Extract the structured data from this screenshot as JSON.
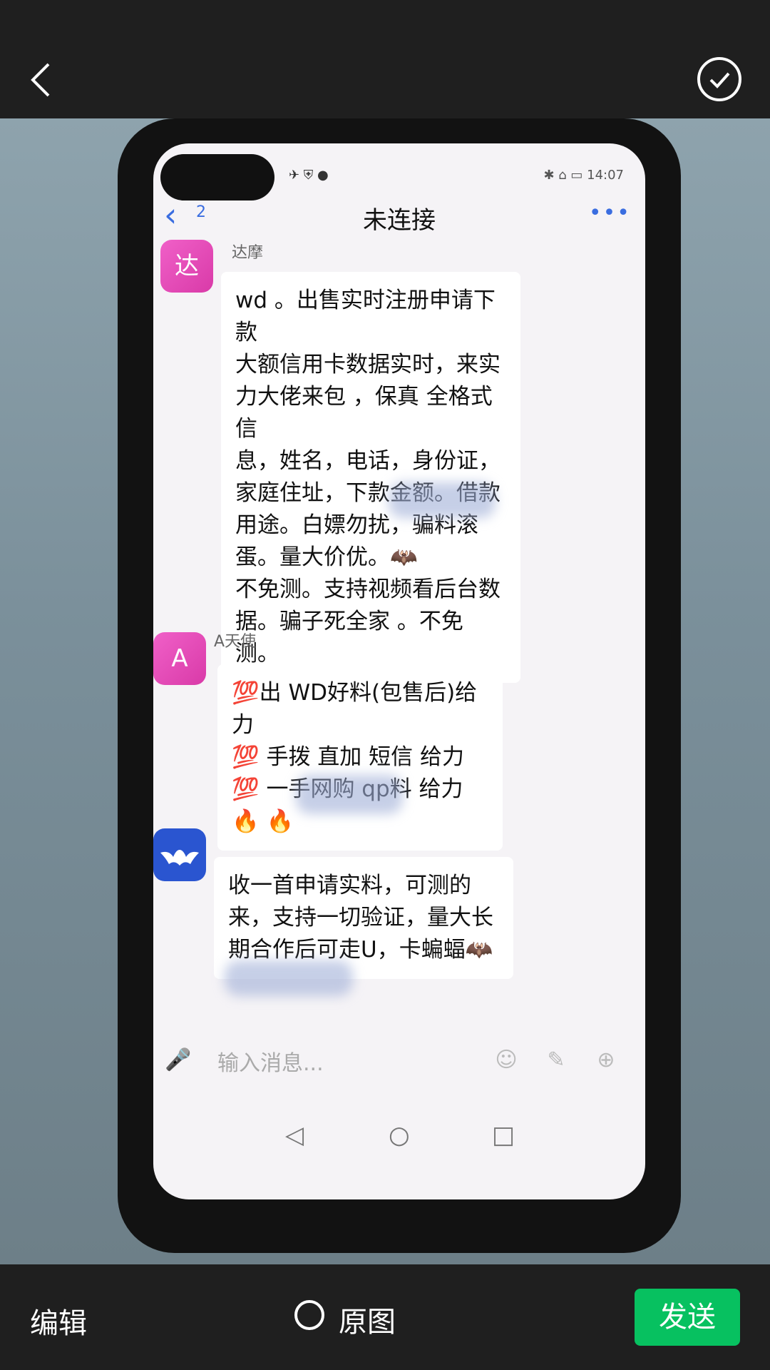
{
  "colors": {
    "accent": "#07c160",
    "link": "#3a6de0"
  },
  "top_bar": {
    "back_icon": "chevron-left-icon",
    "confirm_icon": "check-circle-icon"
  },
  "chat": {
    "status_left": "✈ ⛨ ●",
    "status_right": "✱ ⌂ ▭ 14:07",
    "back_icon": "chevron-left-icon",
    "unread_count": "2",
    "title": "未连接",
    "more_icon": "more-dots-icon",
    "messages": [
      {
        "avatar": "达",
        "sender": "达摩",
        "lines": [
          "wd 。出售实时注册申请下款",
          "大额信用卡数据实时，来实",
          "力大佬来包 ，保真 全格式信",
          "息，姓名，电话，身份证，",
          "家庭住址，下款金额。借款",
          "用途。白嫖勿扰，骗料滚",
          "蛋。量大价优。🦇",
          "不免测。支持视频看后台数",
          "据。骗子死全家 。不免测。"
        ]
      },
      {
        "avatar": "A",
        "sender": "A天使",
        "lines": [
          "💯出 WD好料(包售后)给力",
          "💯 手拨  直加  短信 给力",
          "💯 一手网购 qp料 给力",
          "🔥                        🔥"
        ]
      },
      {
        "avatar": "bat-icon",
        "sender": "",
        "lines": [
          "收一首申请实料，可测的",
          "来，支持一切验证，量大长",
          "期合作后可走U，卡蝙蝠🦇"
        ]
      }
    ],
    "input_placeholder": "输入消息...",
    "icons": [
      "microphone-icon",
      "emoji-icon",
      "brush-icon",
      "plus-icon"
    ],
    "sys_nav": [
      "◁",
      "○",
      "□"
    ]
  },
  "bottom_bar": {
    "edit": "编辑",
    "original": "原图",
    "send": "发送"
  }
}
